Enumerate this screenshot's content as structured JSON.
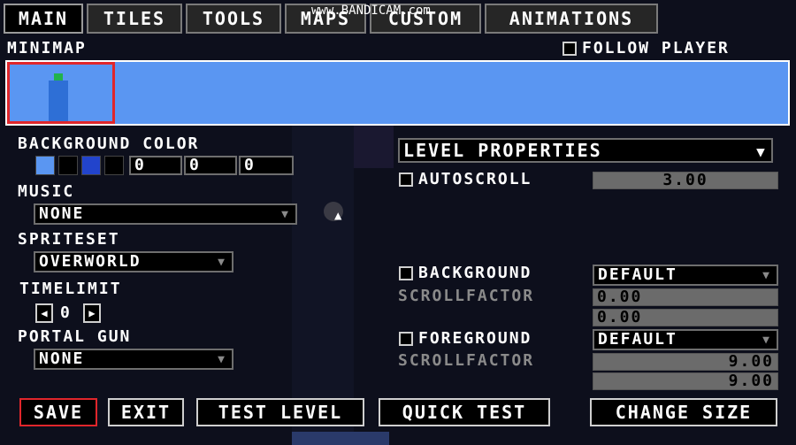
{
  "watermark": "www.BANDICAM.com",
  "tabs": [
    {
      "label": "MAIN"
    },
    {
      "label": "TILES"
    },
    {
      "label": "TOOLS"
    },
    {
      "label": "MAPS"
    },
    {
      "label": "CUSTOM"
    },
    {
      "label": "ANIMATIONS"
    }
  ],
  "minimap": {
    "title": "MINIMAP",
    "follow_player_label": "FOLLOW PLAYER",
    "follow_player_checked": false,
    "sky_color": "#5a96f2"
  },
  "background_color": {
    "label": "BACKGROUND COLOR",
    "swatches": [
      "#5a96f2",
      "#000000",
      "#2244cc",
      "#000000"
    ],
    "values": [
      "0",
      "0",
      "0"
    ]
  },
  "music": {
    "label": "MUSIC",
    "selected": "NONE"
  },
  "spriteset": {
    "label": "SPRITESET",
    "selected": "OVERWORLD"
  },
  "timelimit": {
    "label": "TIMELIMIT",
    "value": "0"
  },
  "portal_gun": {
    "label": "PORTAL GUN",
    "selected": "NONE"
  },
  "level_properties": {
    "selected": "LEVEL PROPERTIES",
    "autoscroll_label": "AUTOSCROLL",
    "autoscroll_checked": false,
    "autoscroll_value": "3.00"
  },
  "background": {
    "label": "BACKGROUND",
    "checked": false,
    "selected": "DEFAULT",
    "scrollfactor_label": "SCROLLFACTOR",
    "scroll_x": "0.00",
    "scroll_y": "0.00"
  },
  "foreground": {
    "label": "FOREGROUND",
    "checked": false,
    "selected": "DEFAULT",
    "scrollfactor_label": "SCROLLFACTOR",
    "scroll_x": "9.00",
    "scroll_y": "9.00"
  },
  "buttons": {
    "save": "SAVE",
    "exit": "EXIT",
    "test_level": "TEST LEVEL",
    "quick_test": "QUICK TEST",
    "change_size": "CHANGE SIZE"
  },
  "colors": {
    "accent_red": "#e0262b",
    "sky_blue": "#5a96f2",
    "field_gray": "#6b6b6b"
  }
}
